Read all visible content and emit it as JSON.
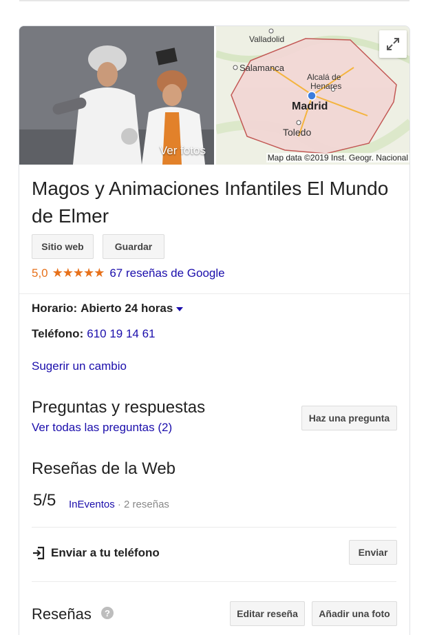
{
  "media": {
    "photos_label": "Ver fotos",
    "map_credit": "Map data ©2019 Inst. Geogr. Nacional",
    "map_labels": {
      "valladolid": "Valladolid",
      "salamanca": "Salamanca",
      "alcala1": "Alcalá de",
      "alcala2": "Henares",
      "madrid": "Madrid",
      "toledo": "Toledo"
    }
  },
  "business": {
    "title": "Magos y Animaciones Infantiles El Mundo de Elmer",
    "website_button": "Sitio web",
    "save_button": "Guardar",
    "rating": "5,0",
    "stars": "★★★★★",
    "reviews_link": "67 reseñas de Google"
  },
  "info": {
    "hours_label": "Horario:",
    "hours_value": "Abierto 24 horas",
    "phone_label": "Teléfono:",
    "phone_value": "610 19 14 61",
    "suggest_edit": "Sugerir un cambio"
  },
  "qa": {
    "title": "Preguntas y respuestas",
    "see_all": "Ver todas las preguntas (2)",
    "ask_button": "Haz una pregunta"
  },
  "web_reviews": {
    "title": "Reseñas de la Web",
    "score": "5/5",
    "source": "InEventos",
    "meta": " · 2 reseñas"
  },
  "send": {
    "label": "Enviar a tu teléfono",
    "button": "Enviar"
  },
  "reviews": {
    "title": "Reseñas",
    "help": "?",
    "edit_button": "Editar reseña",
    "add_photo_button": "Añadir una foto"
  },
  "colors": {
    "link": "#1a0dab",
    "rating": "#e7711b",
    "text": "#222222"
  }
}
